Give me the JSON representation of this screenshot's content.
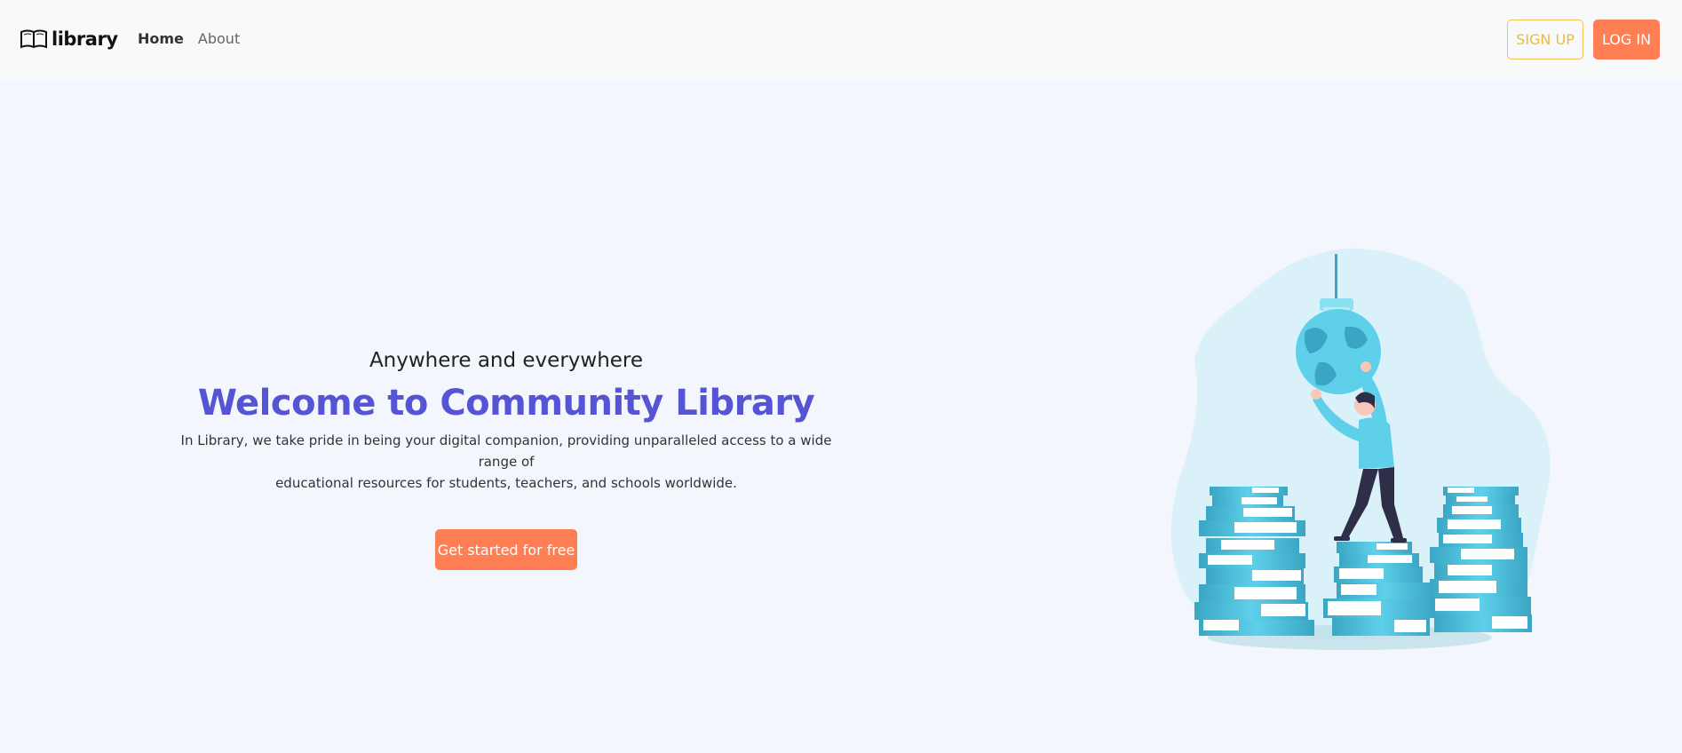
{
  "brand": {
    "name": "library",
    "icon": "open-book-icon"
  },
  "nav": {
    "links": [
      {
        "label": "Home",
        "active": true
      },
      {
        "label": "About",
        "active": false
      }
    ]
  },
  "auth": {
    "signup_label": "SIGN UP",
    "login_label": "LOG IN"
  },
  "hero": {
    "subtitle": "Anywhere and everywhere",
    "title": "Welcome to Community Library",
    "description_line1": "In Library, we take pride in being your digital companion, providing unparalleled access to a wide range of",
    "description_line2": "educational resources for students, teachers, and schools worldwide.",
    "cta_label": "Get started for free"
  },
  "colors": {
    "accent": "#ff7f54",
    "title": "#5454d4",
    "signup": "#f0b93a",
    "illustration": "#5fd0ea"
  },
  "illustration": {
    "icon": "person-holding-globe-on-books-illustration"
  }
}
